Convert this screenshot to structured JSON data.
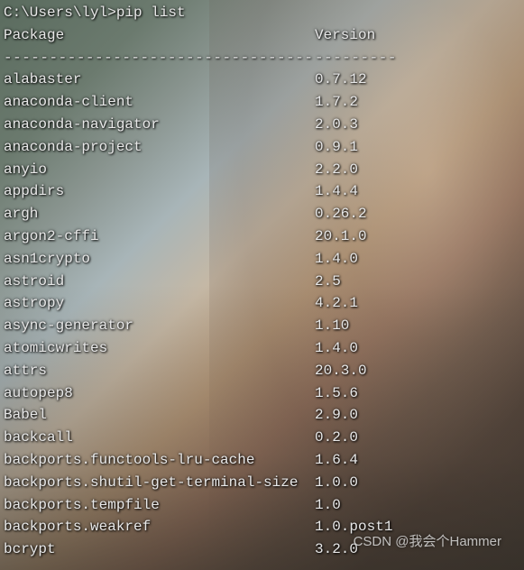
{
  "prompt": "C:\\Users\\lyl>pip list",
  "headers": {
    "package": "Package",
    "version": "Version"
  },
  "divider": {
    "package": "----------------------------------",
    "version": "---------"
  },
  "packages": [
    {
      "name": "alabaster",
      "version": "0.7.12"
    },
    {
      "name": "anaconda-client",
      "version": "1.7.2"
    },
    {
      "name": "anaconda-navigator",
      "version": "2.0.3"
    },
    {
      "name": "anaconda-project",
      "version": "0.9.1"
    },
    {
      "name": "anyio",
      "version": "2.2.0"
    },
    {
      "name": "appdirs",
      "version": "1.4.4"
    },
    {
      "name": "argh",
      "version": "0.26.2"
    },
    {
      "name": "argon2-cffi",
      "version": "20.1.0"
    },
    {
      "name": "asn1crypto",
      "version": "1.4.0"
    },
    {
      "name": "astroid",
      "version": "2.5"
    },
    {
      "name": "astropy",
      "version": "4.2.1"
    },
    {
      "name": "async-generator",
      "version": "1.10"
    },
    {
      "name": "atomicwrites",
      "version": "1.4.0"
    },
    {
      "name": "attrs",
      "version": "20.3.0"
    },
    {
      "name": "autopep8",
      "version": "1.5.6"
    },
    {
      "name": "Babel",
      "version": "2.9.0"
    },
    {
      "name": "backcall",
      "version": "0.2.0"
    },
    {
      "name": "backports.functools-lru-cache",
      "version": "1.6.4"
    },
    {
      "name": "backports.shutil-get-terminal-size",
      "version": "1.0.0"
    },
    {
      "name": "backports.tempfile",
      "version": "1.0"
    },
    {
      "name": "backports.weakref",
      "version": "1.0.post1"
    },
    {
      "name": "bcrypt",
      "version": "3.2.0"
    }
  ],
  "watermark": "CSDN @我会个Hammer"
}
